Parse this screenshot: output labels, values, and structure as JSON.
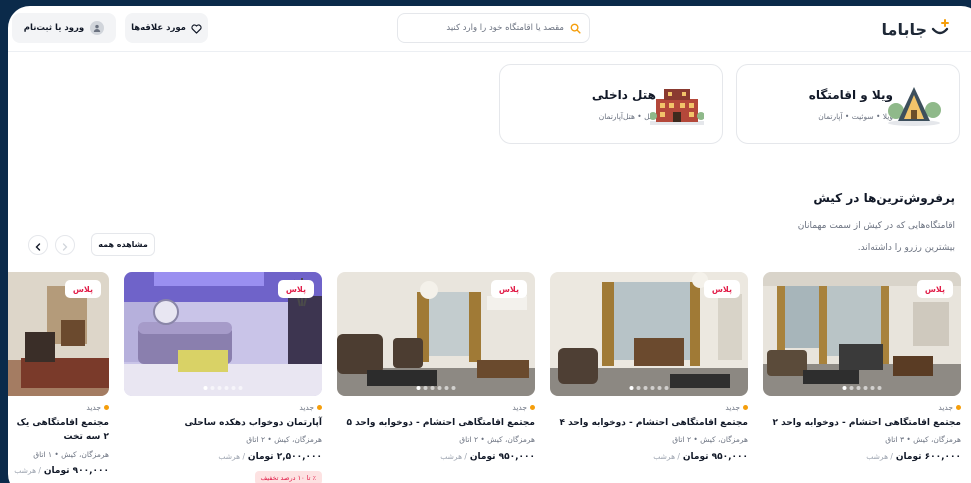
{
  "header": {
    "logo_text": "جاباما",
    "search_placeholder": "مقصد یا اقامتگاه خود را وارد کنید",
    "favorites_label": "مورد علاقه‌ها",
    "login_label": "ورود یا ثبت‌نام"
  },
  "categories": [
    {
      "title": "ویلا و اقامتگاه",
      "subtitle": "ویلا • سوئیت • آپارتمان",
      "icon": "villa-icon"
    },
    {
      "title": "هتل داخلی",
      "subtitle": "هتل • هتل‌آپارتمان",
      "icon": "hotel-icon"
    }
  ],
  "section": {
    "title": "پرفروش‌ترین‌ها در کیش",
    "description": "اقامتگاه‌هایی که در کیش از سمت مهمانان بیشترین رزرو را داشته‌اند.",
    "see_all": "مشاهده همه"
  },
  "listings": [
    {
      "badge": "پلاس",
      "tag": "جدید",
      "title": "مجتمع اقامتگاهی احتشام - دوخوابه واحد ۲",
      "location": "هرمزگان، کیش • ۳ اتاق",
      "price": "۶۰۰,۰۰۰ تومان",
      "per": "/ هرشب"
    },
    {
      "badge": "پلاس",
      "tag": "جدید",
      "title": "مجتمع اقامتگاهی احتشام - دوخوابه واحد ۴",
      "location": "هرمزگان، کیش • ۲ اتاق",
      "price": "۹۵۰,۰۰۰ تومان",
      "per": "/ هرشب"
    },
    {
      "badge": "پلاس",
      "tag": "جدید",
      "title": "مجتمع اقامتگاهی احتشام - دوخوابه واحد ۵",
      "location": "هرمزگان، کیش • ۲ اتاق",
      "price": "۹۵۰,۰۰۰ تومان",
      "per": "/ هرشب"
    },
    {
      "badge": "پلاس",
      "tag": "جدید",
      "title": "آپارتمان دوخواب دهکده ساحلی",
      "location": "هرمزگان، کیش • ۲ اتاق",
      "price": "۲,۵۰۰,۰۰۰ تومان",
      "per": "/ هرشب",
      "discount": "٪ تا ۱۰ درصد تخفیف"
    },
    {
      "badge": "پلاس",
      "tag": "جدید",
      "title": "مجتمع اقامتگاهی یک",
      "title2": "۲ سه تخت",
      "location": "هرمزگان، کیش • ۱ اتاق",
      "price": "۹۰۰,۰۰۰ تومان",
      "per": "/ هرشب"
    }
  ],
  "colors": {
    "accent": "#f59e0b",
    "badge": "#e11d48",
    "frame": "#0b2a4a"
  }
}
